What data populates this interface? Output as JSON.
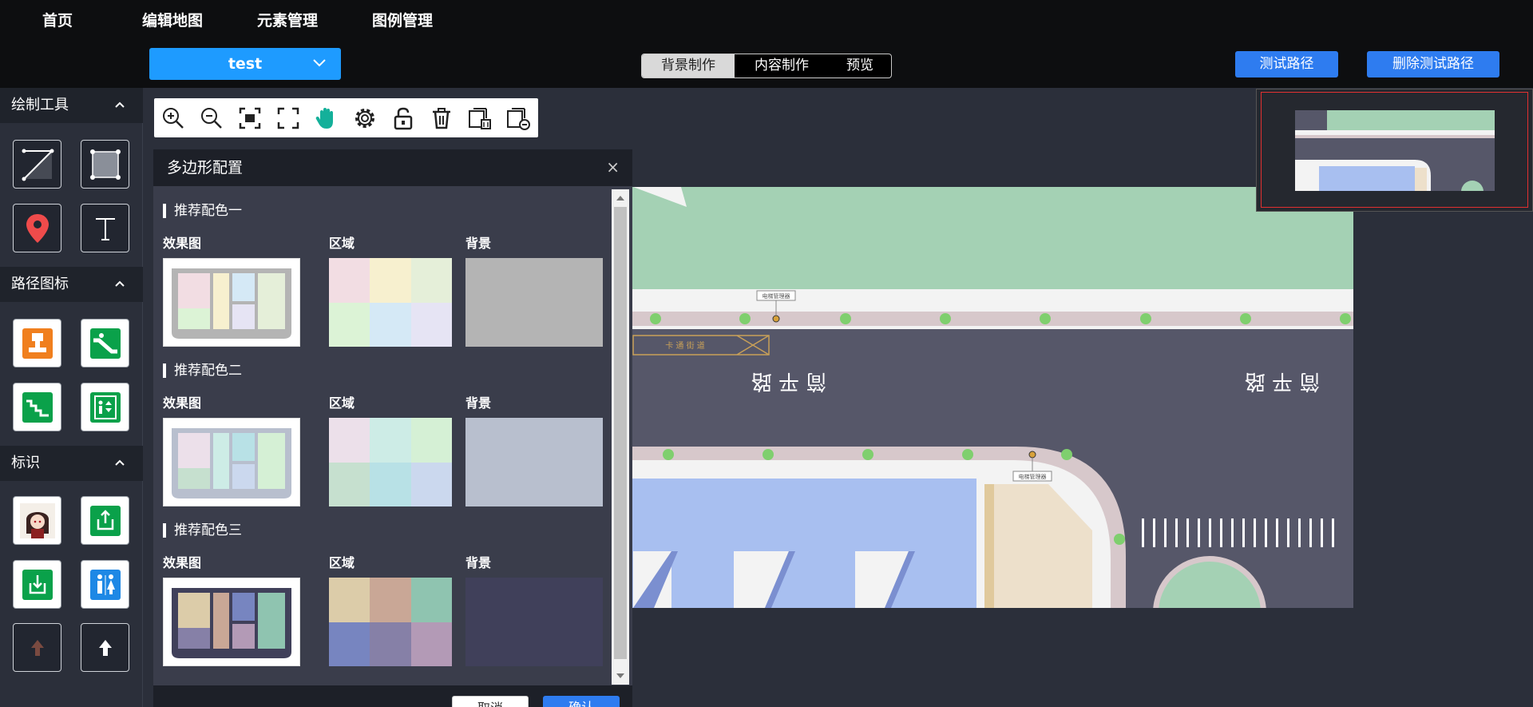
{
  "nav": {
    "items": [
      "首页",
      "编辑地图",
      "元素管理",
      "图例管理"
    ]
  },
  "project_select": {
    "value": "test"
  },
  "mode_tabs": [
    {
      "label": "背景制作",
      "active": true
    },
    {
      "label": "内容制作",
      "active": false
    },
    {
      "label": "预览",
      "active": false
    }
  ],
  "actions": {
    "test_path": "测试路径",
    "delete_test_path": "删除测试路径"
  },
  "sidebar": {
    "draw_tools": {
      "title": "绘制工具",
      "tools": [
        "line-tool-icon",
        "rectangle-tool-icon",
        "location-pin-icon",
        "text-tool-icon"
      ]
    },
    "path_icons": {
      "title": "路径图标",
      "icons": [
        "service-desk-icon",
        "escalator-icon",
        "stairs-icon",
        "elevator-icon"
      ]
    },
    "markers": {
      "title": "标识",
      "icons": [
        "character-avatar-icon",
        "exit-icon",
        "entrance-icon",
        "restroom-icon",
        "arrow-up-brown-icon",
        "arrow-up-white-icon"
      ]
    }
  },
  "map_toolbar": [
    "zoom-in-icon",
    "zoom-out-icon",
    "fit-screen-icon",
    "fullscreen-icon",
    "hand-pan-icon",
    "settings-icon",
    "unlock-icon",
    "delete-icon",
    "delete-layer-icon",
    "remove-layer-icon"
  ],
  "canvas_labels": {
    "road_left": "简 平 路",
    "road_right": "简 平 路",
    "tag_a": "电梯管理器",
    "tag_b": "电梯管理器",
    "sign": "卡 通 街 道"
  },
  "dialog": {
    "title": "多边形配置",
    "close": "×",
    "col_preview": "效果图",
    "col_region": "区域",
    "col_background": "背景",
    "schemes": [
      {
        "title": "推荐配色一",
        "region_colors": [
          "#f2dde3",
          "#f7f0cf",
          "#e5efd9",
          "#dcf3d6",
          "#d5e9f6",
          "#e6e4f4"
        ],
        "background": "#b4b4b4"
      },
      {
        "title": "推荐配色二",
        "region_colors": [
          "#ece0ea",
          "#cdece6",
          "#d5f0d5",
          "#c6e0cf",
          "#b8e1e6",
          "#cbd8ee"
        ],
        "background": "#b8bfce"
      },
      {
        "title": "推荐配色三",
        "region_colors": [
          "#dccca9",
          "#c9a796",
          "#8fc4b0",
          "#7785c0",
          "#8680a7",
          "#b39ab6"
        ],
        "background": "#40405a"
      }
    ],
    "cancel": "取消",
    "confirm": "确认"
  }
}
